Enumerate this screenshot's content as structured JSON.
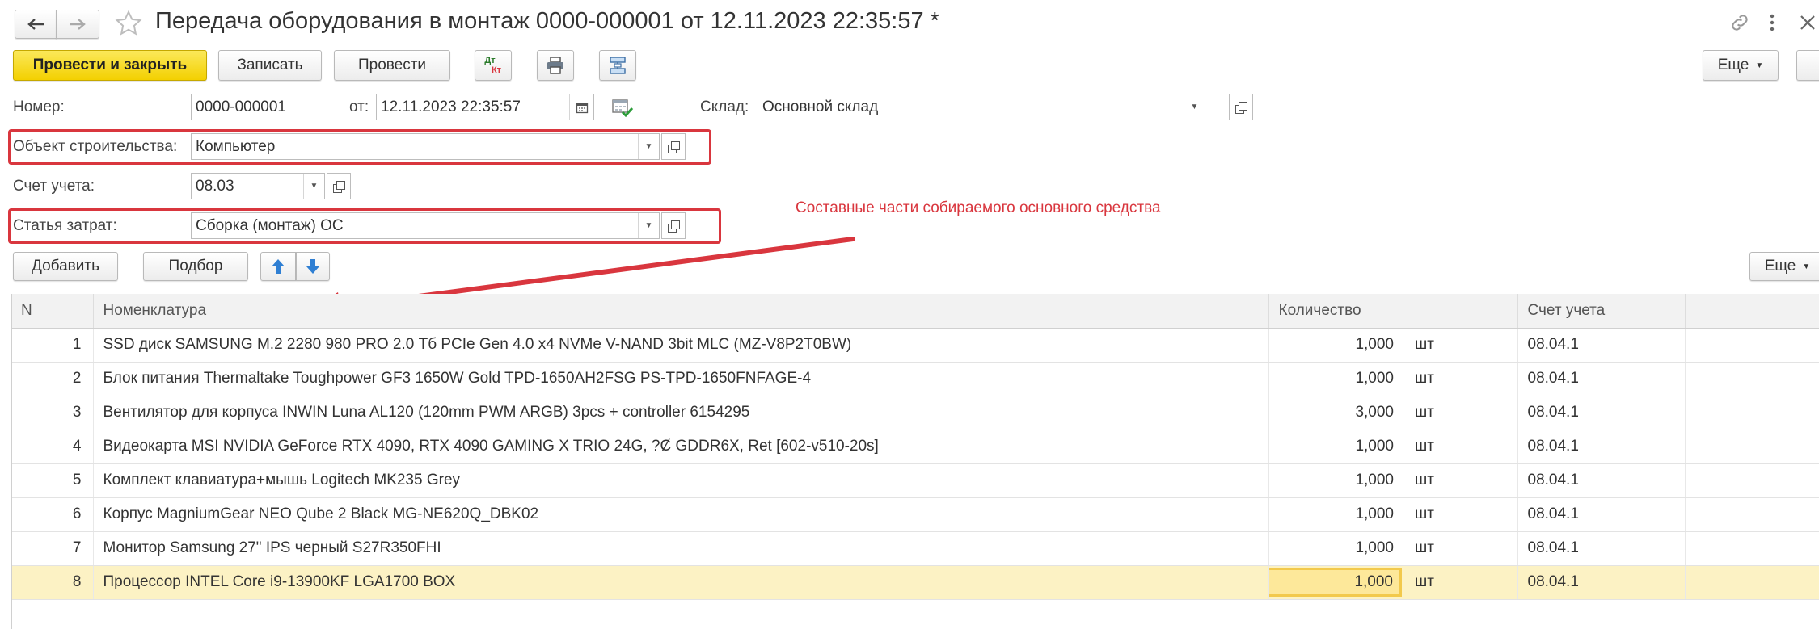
{
  "window": {
    "title": "Передача оборудования в монтаж 0000-000001 от 12.11.2023 22:35:57 *"
  },
  "toolbar": {
    "post_close_label": "Провести и закрыть",
    "save_label": "Записать",
    "post_label": "Провести",
    "dtkt_top": "Дт",
    "dtkt_bottom": "Кт",
    "more_label": "Еще"
  },
  "header": {
    "number_label": "Номер:",
    "number_value": "0000-000001",
    "date_label": "от:",
    "date_value": "12.11.2023 22:35:57",
    "warehouse_label": "Склад:",
    "warehouse_value": "Основной склад",
    "object_label": "Объект строительства:",
    "object_value": "Компьютер",
    "account_label": "Счет учета:",
    "account_value": "08.03",
    "cost_label": "Статья затрат:",
    "cost_value": "Сборка (монтаж) ОС"
  },
  "annotation": {
    "text": "Составные части собираемого основного средства",
    "color": "#d9363e"
  },
  "table_toolbar": {
    "add_label": "Добавить",
    "pick_label": "Подбор",
    "more_label": "Еще"
  },
  "table": {
    "columns": [
      "N",
      "Номенклатура",
      "Количество",
      "Счет учета"
    ],
    "rows": [
      {
        "n": "1",
        "name": "SSD диск SAMSUNG M.2 2280 980 PRO 2.0 Тб PCIe Gen 4.0 x4 NVMe V-NAND 3bit MLC (MZ-V8P2T0BW)",
        "qty": "1,000",
        "unit": "шт",
        "account": "08.04.1"
      },
      {
        "n": "2",
        "name": "Блок питания Thermaltake Toughpower GF3 1650W Gold TPD-1650AH2FSG PS-TPD-1650FNFAGE-4",
        "qty": "1,000",
        "unit": "шт",
        "account": "08.04.1"
      },
      {
        "n": "3",
        "name": "Вентилятор для корпуса INWIN Luna AL120 (120mm PWM ARGB) 3pcs + controller 6154295",
        "qty": "3,000",
        "unit": "шт",
        "account": "08.04.1"
      },
      {
        "n": "4",
        "name": "Видеокарта MSI NVIDIA GeForce RTX 4090, RTX 4090 GAMING X TRIO 24G, ?Ȼ GDDR6X, Ret [602-v510-20s]",
        "qty": "1,000",
        "unit": "шт",
        "account": "08.04.1"
      },
      {
        "n": "5",
        "name": "Комплект клавиатура+мышь Logitech MK235 Grey",
        "qty": "1,000",
        "unit": "шт",
        "account": "08.04.1"
      },
      {
        "n": "6",
        "name": "Корпус MagniumGear NEO Qube 2 Black MG-NE620Q_DBK02",
        "qty": "1,000",
        "unit": "шт",
        "account": "08.04.1"
      },
      {
        "n": "7",
        "name": "Монитор Samsung 27\" IPS черный S27R350FHI",
        "qty": "1,000",
        "unit": "шт",
        "account": "08.04.1"
      },
      {
        "n": "8",
        "name": "Процессор INTEL Core i9-13900KF LGA1700 BOX",
        "qty": "1,000",
        "unit": "шт",
        "account": "08.04.1"
      }
    ]
  },
  "colors": {
    "accent_yellow": "#f3d000",
    "highlight_red": "#d9363e",
    "selected_row": "#fcf2c4",
    "arrow_blue": "#2f7fd3"
  }
}
